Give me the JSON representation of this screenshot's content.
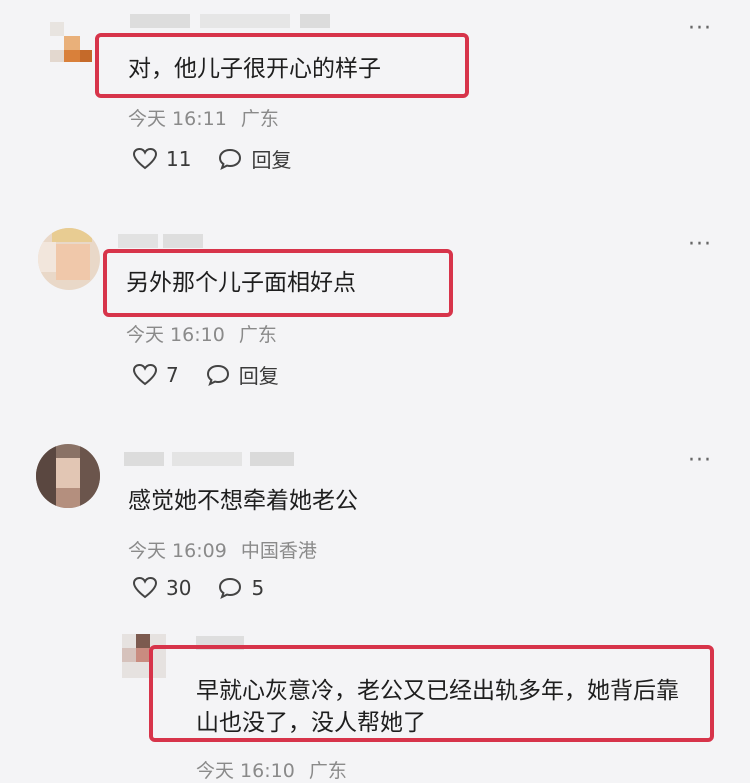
{
  "comments": [
    {
      "text": "对，他儿子很开心的样子",
      "time": "今天 16:11",
      "location": "广东",
      "likes": "11",
      "reply_label": "回复"
    },
    {
      "text": "另外那个儿子面相好点",
      "time": "今天 16:10",
      "location": "广东",
      "likes": "7",
      "reply_label": "回复"
    },
    {
      "text": "感觉她不想牵着她老公",
      "time": "今天 16:09",
      "location": "中国香港",
      "likes": "30",
      "replies": "5"
    }
  ],
  "reply": {
    "line1": "早就心灰意冷，老公又已经出轨多年，她背后靠",
    "line2": "山也没了，没人帮她了",
    "time": "今天 16:10",
    "location": "广东"
  },
  "colors": {
    "highlight": "#d7344a",
    "meta": "#8a8a8a",
    "background": "#f4f4f6"
  }
}
